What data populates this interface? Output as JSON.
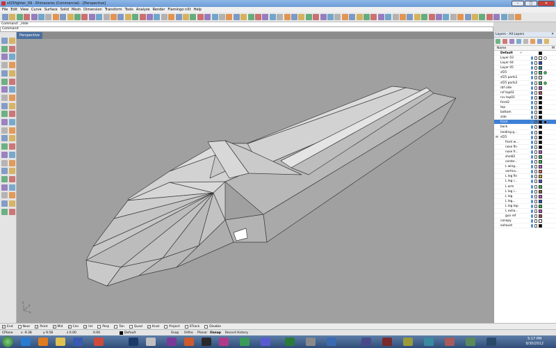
{
  "window": {
    "title": "sf25fighter_09 - Rhinoceros (Commercial) - [Perspective]",
    "min_label": "–",
    "max_label": "□",
    "close_label": "✕"
  },
  "menu": [
    "File",
    "Edit",
    "View",
    "Curve",
    "Surface",
    "Solid",
    "Mesh",
    "Dimension",
    "Transform",
    "Tools",
    "Analyze",
    "Render",
    "Flamingo nXt",
    "Help"
  ],
  "command": {
    "history": "Command: _Hide",
    "prompt": "Command:"
  },
  "viewport": {
    "tab_label": "Perspective",
    "axes": {
      "x": "x",
      "y": "y",
      "z": "z"
    }
  },
  "layers_panel": {
    "title": "Layers - All Layers",
    "column_name": "Name",
    "column_m": "M",
    "layers": [
      {
        "name": "Default",
        "bold": true,
        "check": "✓",
        "color": "#000000",
        "indent": 0
      },
      {
        "name": "Layer 03",
        "color": "#ffffff",
        "indent": 0,
        "material": true
      },
      {
        "name": "Layer 04",
        "color": "#2a4fc9",
        "indent": 0
      },
      {
        "name": "Layer 05",
        "color": "#1c9c9c",
        "indent": 0
      },
      {
        "name": "sf25",
        "color": "#2bb54a",
        "indent": 0,
        "material": true
      },
      {
        "name": "sf25 parts1",
        "color": "#ffffff",
        "indent": 0
      },
      {
        "name": "sf25 parts2",
        "color": "#2bb54a",
        "indent": 0,
        "material": true
      },
      {
        "name": "rbf side",
        "color": "#c04cc8",
        "indent": 0
      },
      {
        "name": "rvf top02",
        "color": "#b04848",
        "indent": 0
      },
      {
        "name": "rvv top01",
        "color": "#000000",
        "indent": 0
      },
      {
        "name": "front2",
        "color": "#000000",
        "indent": 0
      },
      {
        "name": "top",
        "color": "#000000",
        "indent": 0
      },
      {
        "name": "bottom",
        "color": "#000000",
        "indent": 0
      },
      {
        "name": "side",
        "color": "#000000",
        "indent": 0
      },
      {
        "name": "front",
        "color": "#000000",
        "indent": 0,
        "selected": true,
        "material": true
      },
      {
        "name": "back",
        "color": "#000000",
        "indent": 0
      },
      {
        "name": "landing g...",
        "color": "#000000",
        "indent": 0
      },
      {
        "name": "sf25",
        "color": "#000000",
        "indent": 0,
        "expander": "⊟"
      },
      {
        "name": "front w...",
        "color": "#000000",
        "indent": 1
      },
      {
        "name": "nose fin",
        "color": "#000000",
        "indent": 1
      },
      {
        "name": "nose fr...",
        "color": "#c04cc8",
        "indent": 1
      },
      {
        "name": "sheld2",
        "color": "#2bb54a",
        "indent": 1
      },
      {
        "name": "center...",
        "color": "#2bb54a",
        "indent": 1
      },
      {
        "name": "L wing...",
        "color": "#c04cc8",
        "indent": 1
      },
      {
        "name": "vertica...",
        "color": "#e05b5b",
        "indent": 1
      },
      {
        "name": "L leg fin",
        "color": "#c8a020",
        "indent": 1
      },
      {
        "name": "L leg i...",
        "color": "#4c4cc8",
        "indent": 1
      },
      {
        "name": "L arm",
        "color": "#2bb54a",
        "indent": 1
      },
      {
        "name": "L leg i...",
        "color": "#8a5a2a",
        "indent": 1
      },
      {
        "name": "L leg",
        "color": "#c04cc8",
        "indent": 1
      },
      {
        "name": "L leg...",
        "color": "#2a4fc9",
        "indent": 1
      },
      {
        "name": "L leg top",
        "color": "#2bb54a",
        "indent": 1
      },
      {
        "name": "L exha...",
        "color": "#c04cc8",
        "indent": 1
      },
      {
        "name": "gun ref",
        "color": "#b04848",
        "indent": 1
      },
      {
        "name": "canopy",
        "color": "#ffffff",
        "indent": 0
      },
      {
        "name": "exhaust",
        "color": "#000000",
        "indent": 0
      }
    ]
  },
  "osnap": [
    {
      "label": "End",
      "checked": true
    },
    {
      "label": "Near",
      "checked": false
    },
    {
      "label": "Point",
      "checked": true
    },
    {
      "label": "Mid",
      "checked": true
    },
    {
      "label": "Cen",
      "checked": true
    },
    {
      "label": "Int",
      "checked": true
    },
    {
      "label": "Perp",
      "checked": false
    },
    {
      "label": "Tan",
      "checked": false
    },
    {
      "label": "Quad",
      "checked": false
    },
    {
      "label": "Knot",
      "checked": true
    },
    {
      "label": "Project",
      "checked": false
    },
    {
      "label": "STrack",
      "checked": false
    },
    {
      "label": "Disable",
      "checked": false
    }
  ],
  "status": {
    "cplane": "CPlane",
    "x": "x -9.38",
    "y": "y 9.58",
    "z": "z 0.00",
    "dist": "0.00",
    "layer": "Default",
    "snap": "Snap",
    "ortho": "Ortho",
    "planar": "Planar",
    "osnap": "Osnap",
    "record": "Record History"
  },
  "clock": {
    "time": "5:17 PM",
    "date": "9/30/2012"
  }
}
